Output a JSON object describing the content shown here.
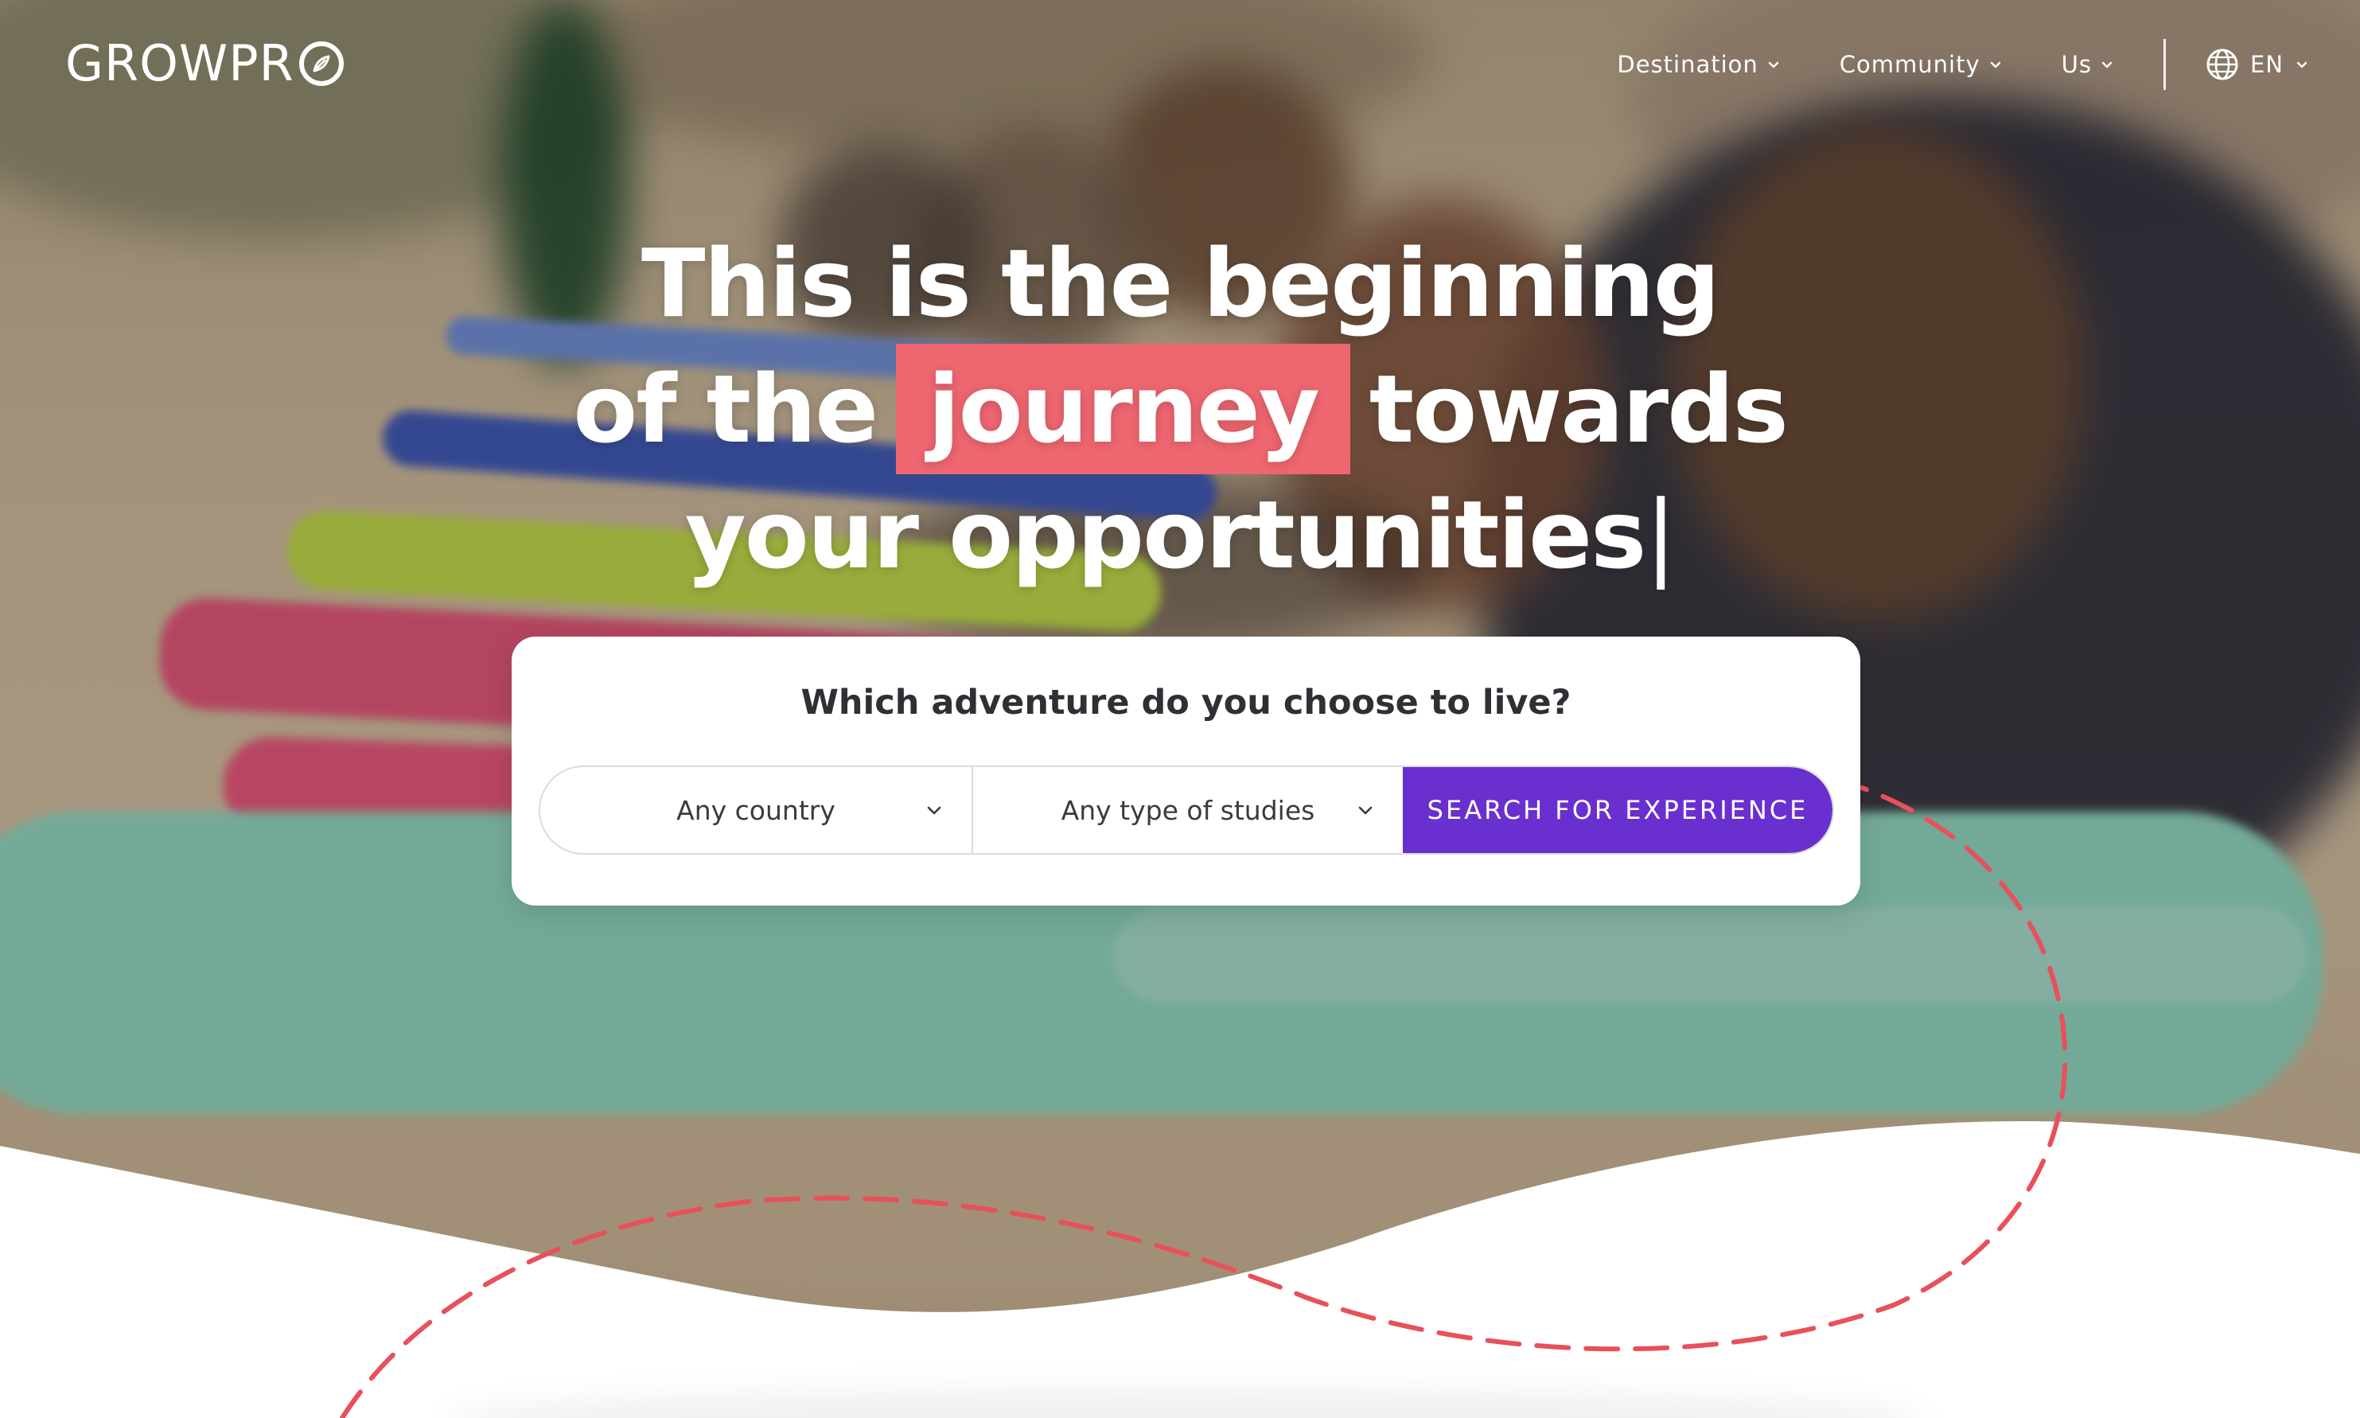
{
  "brand": {
    "name": "GROWPRO"
  },
  "nav": {
    "items": [
      {
        "label": "Destination"
      },
      {
        "label": "Community"
      },
      {
        "label": "Us"
      }
    ],
    "language": "EN"
  },
  "hero": {
    "line1": "This is the beginning",
    "line2_pre": "of the",
    "line2_highlight": "journey",
    "line2_post": "towards",
    "line3": "your opportunities",
    "cursor": "|"
  },
  "search": {
    "title": "Which adventure do you choose to live?",
    "country_value": "Any country",
    "studies_value": "Any type of studies",
    "button_label": "SEARCH FOR EXPERIENCE"
  },
  "colors": {
    "accent_purple": "#6a2fcf",
    "highlight_coral": "#ee6670",
    "dashed_path": "#e8505b"
  },
  "icons": {
    "logo_mark": "compass-leaf-icon",
    "dropdown": "chevron-down-icon",
    "language": "globe-icon"
  }
}
